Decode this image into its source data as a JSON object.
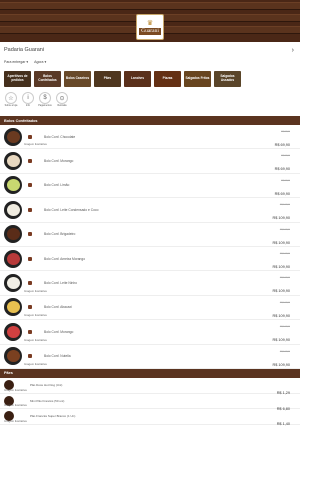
{
  "header": {
    "logo_text": "Guarani",
    "crown_glyph": "♛"
  },
  "store": {
    "name": "Padaria Guarani",
    "arrow": "›"
  },
  "options": {
    "delivery": "Para entregar ▾",
    "now": "Agora ▾"
  },
  "categories": [
    {
      "label": "Aperitivos de pedidos",
      "color": "#6b4a2d"
    },
    {
      "label": "Bolos Confeitados",
      "color": "#8a5a3c"
    },
    {
      "label": "Bolos Caseiros",
      "color": "#a07040"
    },
    {
      "label": "Pães",
      "color": "#7a5530"
    },
    {
      "label": "Lanches",
      "color": "#8b4a2a"
    },
    {
      "label": "Pizzas",
      "color": "#9a4a20"
    },
    {
      "label": "Salgados Fritos",
      "color": "#a06a30"
    },
    {
      "label": "Salgados Assados",
      "color": "#8a6a40"
    }
  ],
  "filters": [
    {
      "label": "Sobre a loja",
      "icon": "☆"
    },
    {
      "label": "Info",
      "icon": "i"
    },
    {
      "label": "Pagamentos",
      "icon": "$"
    },
    {
      "label": "Retirada",
      "icon": "⊙"
    }
  ],
  "section1": {
    "title": "Bolos Confeitados"
  },
  "products": [
    {
      "name": "Bolo Conf. Chocolate",
      "old": "R$ 69,90",
      "price": "R$ 69,90",
      "note": "Imagem ilustrativa",
      "color": "#6a3a20"
    },
    {
      "name": "Bolo Conf. Morango",
      "old": "R$ 69,90",
      "price": "R$ 69,90",
      "note": "",
      "color": "#e8d8c0"
    },
    {
      "name": "Bolo Conf. Limão",
      "old": "R$ 69,90",
      "price": "R$ 69,90",
      "note": "",
      "color": "#c9d870"
    },
    {
      "name": "Bolo Conf. Leite Condensado e Coco",
      "old": "R$ 109,90",
      "price": "R$ 109,90",
      "note": "",
      "color": "#f0ece0"
    },
    {
      "name": "Bolo Conf. Brigadeiro",
      "old": "R$ 109,90",
      "price": "R$ 109,90",
      "note": "",
      "color": "#5a2c18"
    },
    {
      "name": "Bolo Conf. Ameixa Morango",
      "old": "R$ 109,90",
      "price": "R$ 109,90",
      "note": "",
      "color": "#b83a3a"
    },
    {
      "name": "Bolo Conf. Leite Ninho",
      "old": "R$ 109,90",
      "price": "R$ 109,90",
      "note": "Imagem ilustrativa",
      "color": "#f2efe6"
    },
    {
      "name": "Bolo Conf. Abacaxi",
      "old": "R$ 109,90",
      "price": "R$ 109,90",
      "note": "Imagem ilustrativa",
      "color": "#e8c050"
    },
    {
      "name": "Bolo Conf. Morango",
      "old": "R$ 109,90",
      "price": "R$ 109,90",
      "note": "Imagem ilustrativa",
      "color": "#d04040"
    },
    {
      "name": "Bolo Conf. Nutella",
      "old": "R$ 109,90",
      "price": "R$ 109,90",
      "note": "Imagem ilustrativa",
      "color": "#7a4020"
    }
  ],
  "section2": {
    "title": "Pães"
  },
  "breads": [
    {
      "name": "Pão Doce Hot Dog (Uni)",
      "price": "R$ 1,29",
      "note": "Imagem ilustrativa"
    },
    {
      "name": "Mini Pão Francês (50 uni)",
      "price": "R$ 6,80",
      "note": "Imagem ilustrativa"
    },
    {
      "name": "Pão Francês Super Branco (1 Un)",
      "price": "R$ 1,40",
      "note": "Imagem ilustrativa"
    }
  ]
}
